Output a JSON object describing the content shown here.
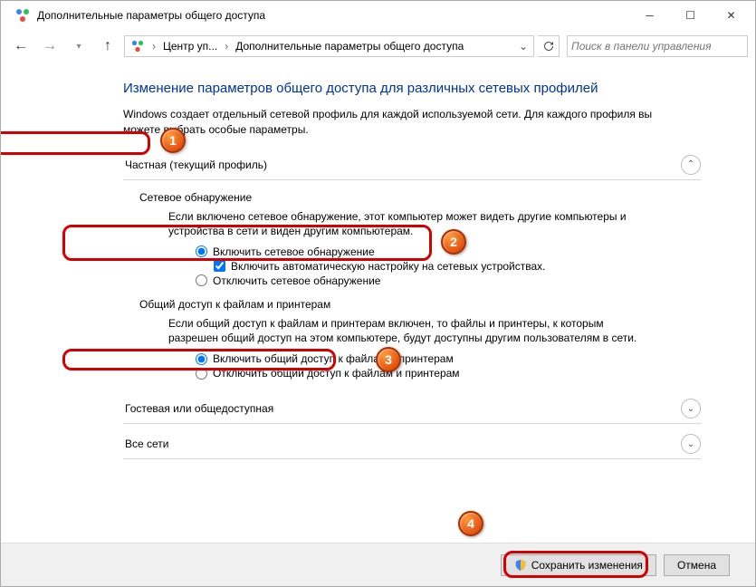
{
  "window": {
    "title": "Дополнительные параметры общего доступа"
  },
  "breadcrumb": {
    "seg1": "Центр уп...",
    "seg2": "Дополнительные параметры общего доступа"
  },
  "search": {
    "placeholder": "Поиск в панели управления"
  },
  "page": {
    "heading": "Изменение параметров общего доступа для различных сетевых профилей",
    "subtext": "Windows создает отдельный сетевой профиль для каждой используемой сети. Для каждого профиля вы можете выбрать особые параметры."
  },
  "profile_private": {
    "label": "Частная (текущий профиль)"
  },
  "netdisc_title": "Сетевое обнаружение",
  "netdisc_desc": "Если включено сетевое обнаружение, этот компьютер может видеть другие компьютеры и устройства в сети и виден другим компьютерам.",
  "netdisc_on": "Включить сетевое обнаружение",
  "netdisc_auto": "Включить автоматическую настройку на сетевых устройствах.",
  "netdisc_off": "Отключить сетевое обнаружение",
  "share_title": "Общий доступ к файлам и принтерам",
  "share_desc": "Если общий доступ к файлам и принтерам включен, то файлы и принтеры, к которым разрешен общий доступ на этом компьютере, будут доступны другим пользователям в сети.",
  "share_on": "Включить общий доступ к файлам и принтерам",
  "share_off": "Отключить общий доступ к файлам и принтерам",
  "profile_guest": {
    "label": "Гостевая или общедоступная"
  },
  "profile_all": {
    "label": "Все сети"
  },
  "buttons": {
    "save": "Сохранить изменения",
    "cancel": "Отмена"
  },
  "badges": {
    "b1": "1",
    "b2": "2",
    "b3": "3",
    "b4": "4"
  }
}
